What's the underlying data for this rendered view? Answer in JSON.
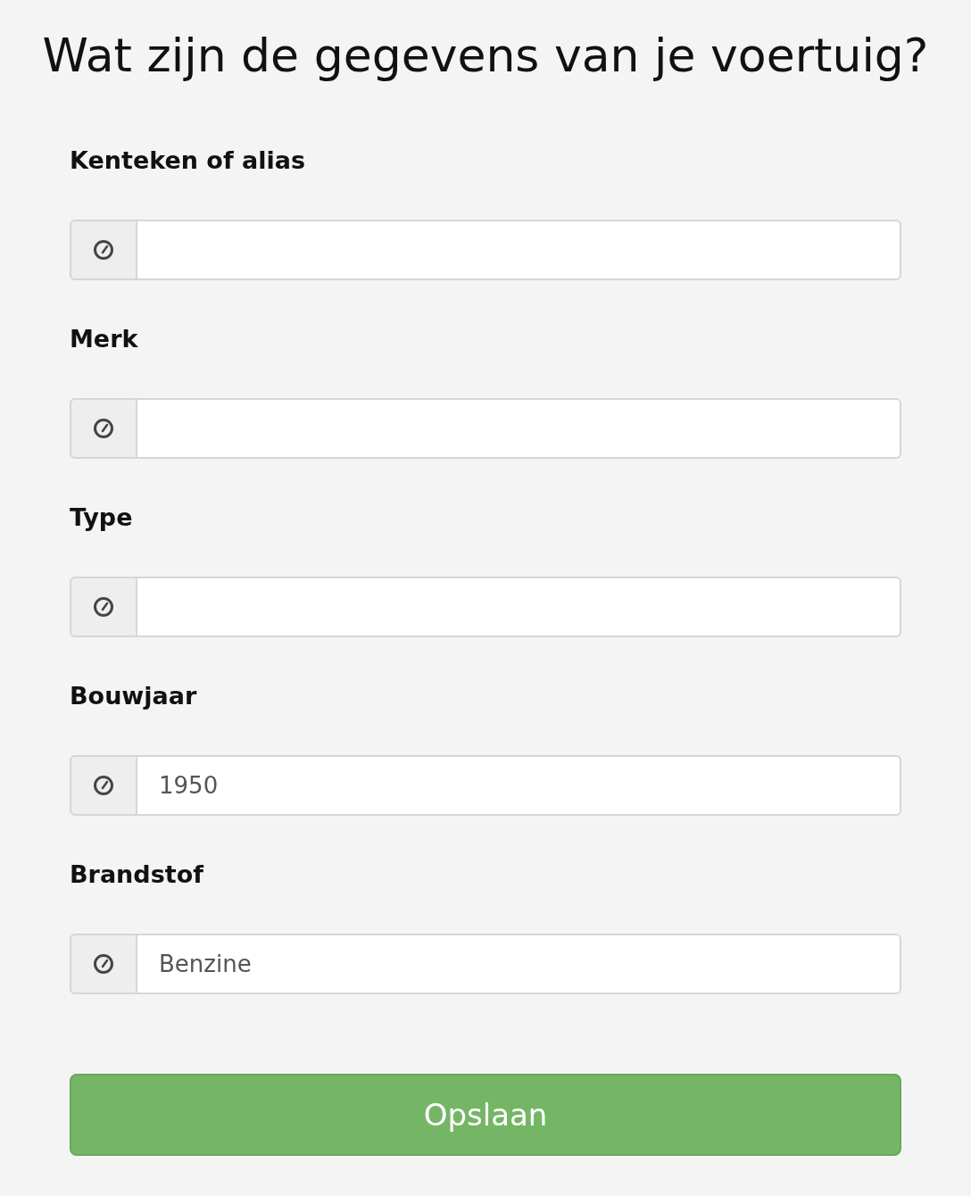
{
  "title": "Wat zijn de gegevens van je voertuig?",
  "fields": [
    {
      "label": "Kenteken of alias"
    },
    {
      "label": "Merk"
    },
    {
      "label": "Type"
    },
    {
      "label": "Bouwjaar",
      "value": "1950"
    },
    {
      "label": "Brandstof",
      "value": "Benzine"
    }
  ],
  "submit": {
    "label": "Opslaan"
  }
}
